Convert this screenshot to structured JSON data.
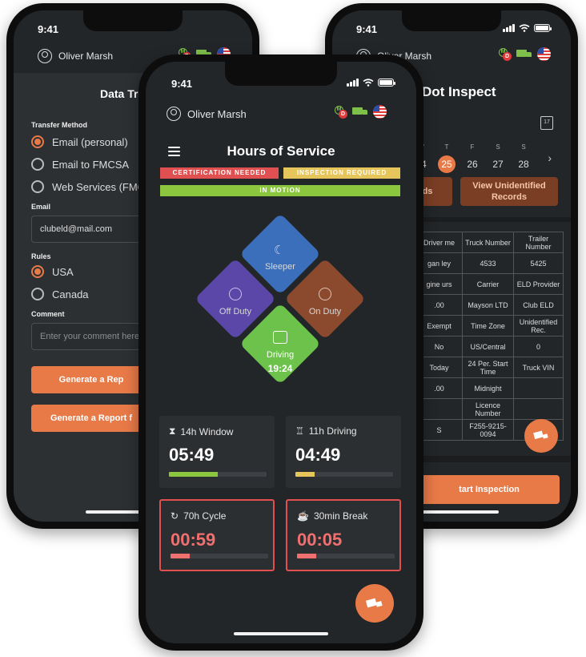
{
  "colors": {
    "accent": "#e87a48",
    "green": "#6cc24a",
    "red": "#e05050",
    "yellow": "#e6c65a",
    "sleeper": "#3c6fbb",
    "offduty": "#5a47a8",
    "onduty": "#8b4a2e"
  },
  "left_screen": {
    "time": "9:41",
    "user": "Oliver Marsh",
    "title": "Data Tra",
    "transfer_label": "Transfer Method",
    "transfer_options": [
      {
        "label": "Email (personal)",
        "selected": true
      },
      {
        "label": "Email to FMCSA",
        "selected": false
      },
      {
        "label": "Web Services (FMC",
        "selected": false
      }
    ],
    "email_label": "Email",
    "email_value": "clubeld@mail.com",
    "rules_label": "Rules",
    "rules_options": [
      {
        "label": "USA",
        "selected": true
      },
      {
        "label": "Canada",
        "selected": false
      }
    ],
    "comment_label": "Comment",
    "comment_placeholder": "Enter your comment here",
    "btn1": "Generate a Rep",
    "btn2": "Generate a Report f"
  },
  "right_screen": {
    "time": "9:41",
    "user": "Oliver Marsh",
    "title": "Dot Inspect",
    "calendar_icon_day": "17",
    "days": [
      {
        "dow": "W",
        "num": "24",
        "selected": false
      },
      {
        "dow": "T",
        "num": "25",
        "selected": true
      },
      {
        "dow": "F",
        "num": "26",
        "selected": false
      },
      {
        "dow": "S",
        "num": "27",
        "selected": false
      },
      {
        "dow": "S",
        "num": "28",
        "selected": false
      }
    ],
    "btn_left": "ds",
    "btn_right": "View Unidentified Records",
    "table": [
      [
        "Driver me",
        "Truck Number",
        "Trailer Number"
      ],
      [
        "gan ley",
        "4533",
        "5425"
      ],
      [
        "gine urs",
        "Carrier",
        "ELD Provider"
      ],
      [
        ".00",
        "Mayson LTD",
        "Club ELD"
      ],
      [
        "Exempt",
        "Time Zone",
        "Unidentified Rec."
      ],
      [
        "No",
        "US/Central",
        "0"
      ],
      [
        "Today",
        "24 Per. Start Time",
        "Truck VIN"
      ],
      [
        ".00",
        "Midnight",
        ""
      ],
      [
        "",
        "Licence Number",
        ""
      ],
      [
        "S",
        "F255-9215-0094",
        ""
      ]
    ],
    "start_btn": "tart Inspection"
  },
  "center_screen": {
    "time": "9:41",
    "user": "Oliver Marsh",
    "title": "Hours of Service",
    "banners": {
      "cert": "CERTIFICATION NEEDED",
      "inspect": "INSPECTION REQUIRED",
      "motion": "IN MOTION"
    },
    "statuses": {
      "sleeper": "Sleeper",
      "off_duty": "Off Duty",
      "on_duty": "On Duty",
      "driving": "Driving",
      "driving_time": "19:24"
    },
    "cards": [
      {
        "label": "14h Window",
        "value": "05:49",
        "progress": 0.5,
        "bar_color": "#8cc63f",
        "alert": false
      },
      {
        "label": "11h Driving",
        "value": "04:49",
        "progress": 0.2,
        "bar_color": "#e6c65a",
        "alert": false
      },
      {
        "label": "70h Cycle",
        "value": "00:59",
        "progress": 0.2,
        "bar_color": "#f07070",
        "alert": true
      },
      {
        "label": "30min Break",
        "value": "00:05",
        "progress": 0.2,
        "bar_color": "#f07070",
        "alert": true
      }
    ]
  }
}
